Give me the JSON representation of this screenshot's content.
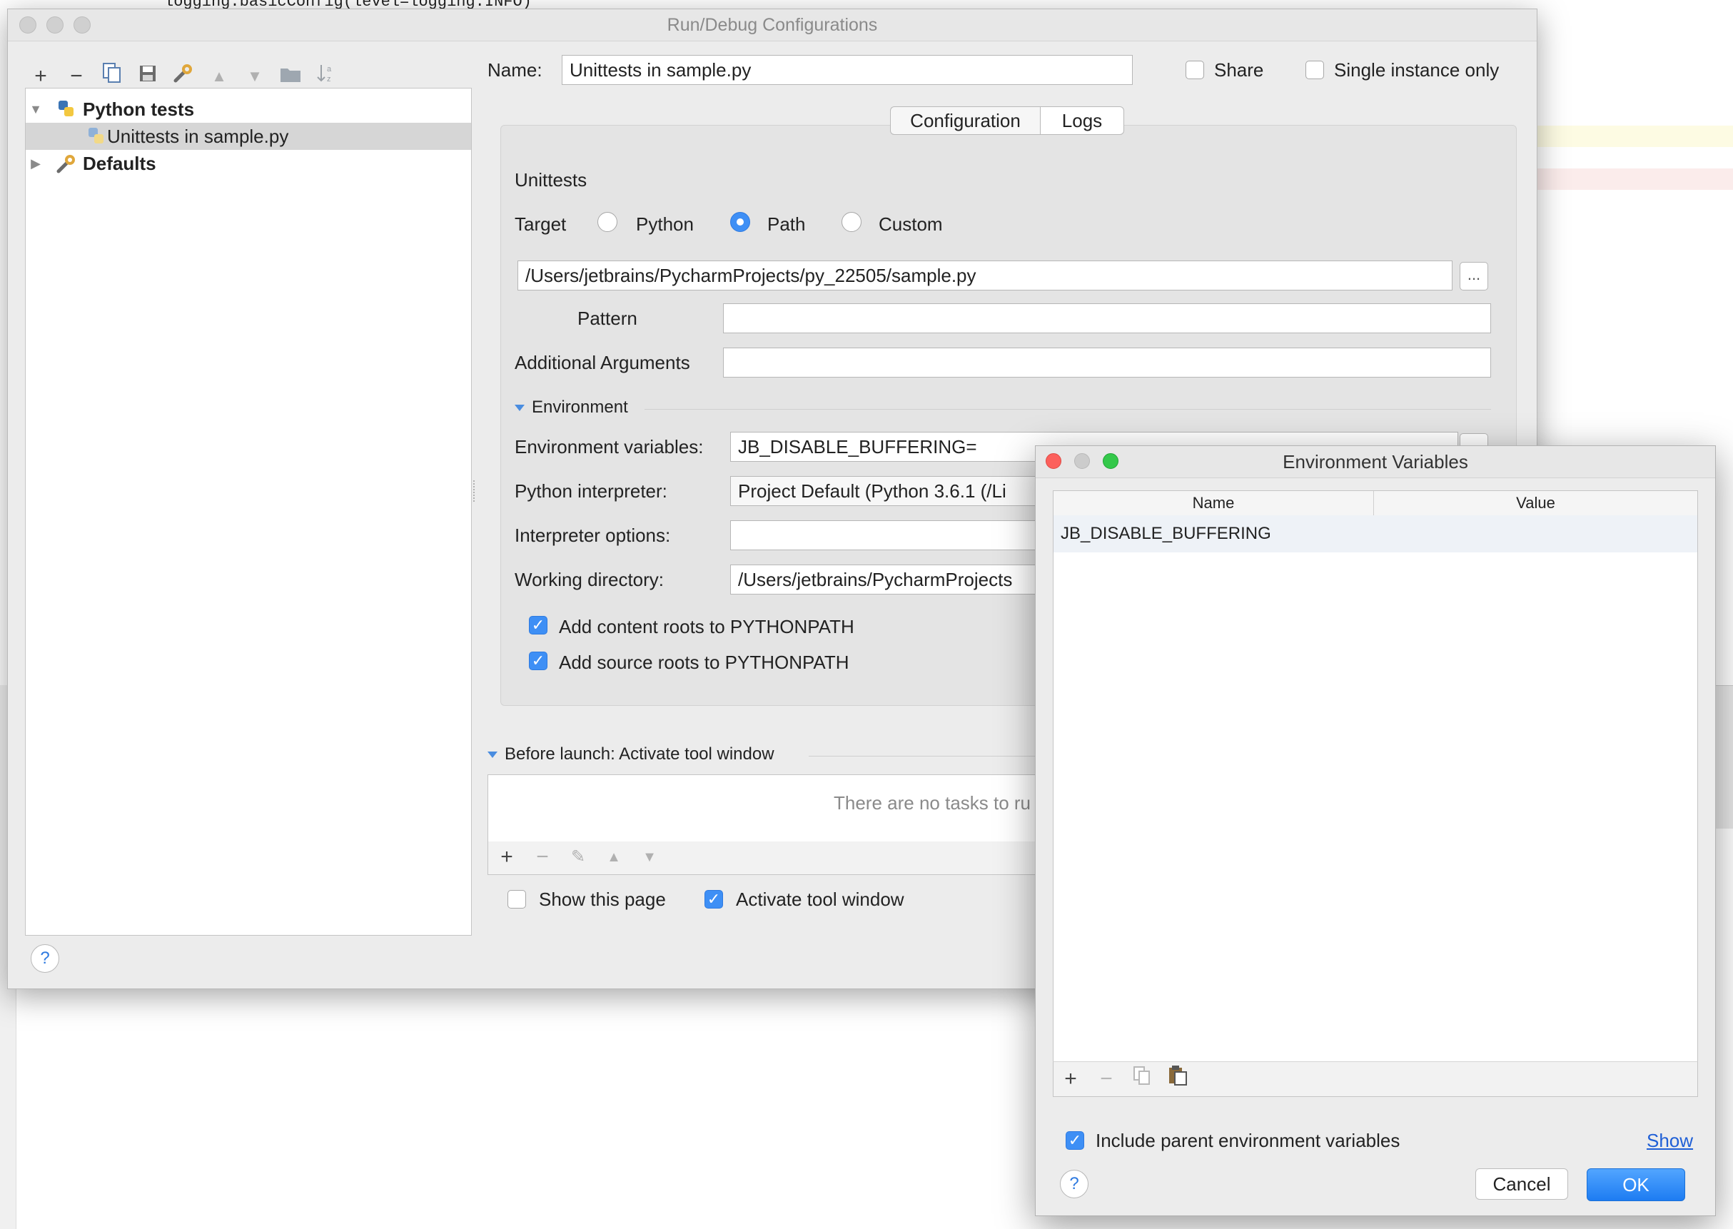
{
  "background": {
    "code_line": "logging.basicConfig(level=logging.INFO)"
  },
  "main_dialog": {
    "title": "Run/Debug Configurations",
    "tree": {
      "items": [
        {
          "label": "Python tests",
          "bold": true
        },
        {
          "label": "Unittests in sample.py",
          "selected": true
        },
        {
          "label": "Defaults",
          "bold": true
        }
      ]
    },
    "name_label": "Name:",
    "name_value": "Unittests in sample.py",
    "share_label": "Share",
    "single_instance_label": "Single instance only",
    "tabs": [
      "Configuration",
      "Logs"
    ],
    "section_title": "Unittests",
    "target_label": "Target",
    "target_options": [
      "Python",
      "Path",
      "Custom"
    ],
    "target_selected": "Path",
    "path_value": "/Users/jetbrains/PycharmProjects/py_22505/sample.py",
    "dots": "...",
    "pattern_label": "Pattern",
    "pattern_value": "",
    "additional_args_label": "Additional Arguments",
    "additional_args_value": "",
    "environment_header": "Environment",
    "env_vars_label": "Environment variables:",
    "env_vars_value": "JB_DISABLE_BUFFERING=",
    "interpreter_label": "Python interpreter:",
    "interpreter_value": "Project Default (Python 3.6.1 (/Li",
    "interpreter_options_label": "Interpreter options:",
    "interpreter_options_value": "",
    "working_dir_label": "Working directory:",
    "working_dir_value": "/Users/jetbrains/PycharmProjects",
    "add_content_roots_label": "Add content roots to PYTHONPATH",
    "add_source_roots_label": "Add source roots to PYTHONPATH",
    "before_launch_label": "Before launch: Activate tool window",
    "no_tasks_text": "There are no tasks to ru",
    "show_page_label": "Show this page",
    "activate_tool_window_label": "Activate tool window",
    "help": "?"
  },
  "env_dialog": {
    "title": "Environment Variables",
    "columns": [
      "Name",
      "Value"
    ],
    "rows": [
      {
        "name": "JB_DISABLE_BUFFERING",
        "value": ""
      }
    ],
    "include_parent_label": "Include parent environment variables",
    "show_link": "Show",
    "cancel_label": "Cancel",
    "ok_label": "OK",
    "help": "?"
  },
  "colors": {
    "accent": "#3e8ff5",
    "close_red": "#fc605c",
    "minimize_gray": "#cccccc",
    "zoom_green": "#34c84a",
    "link": "#1f5fd6"
  },
  "icons": {
    "toolbar": [
      "add-icon",
      "remove-icon",
      "copy-icon",
      "save-icon",
      "wrench-icon",
      "move-up-icon",
      "move-down-icon",
      "folder-icon",
      "sort-icon"
    ]
  }
}
